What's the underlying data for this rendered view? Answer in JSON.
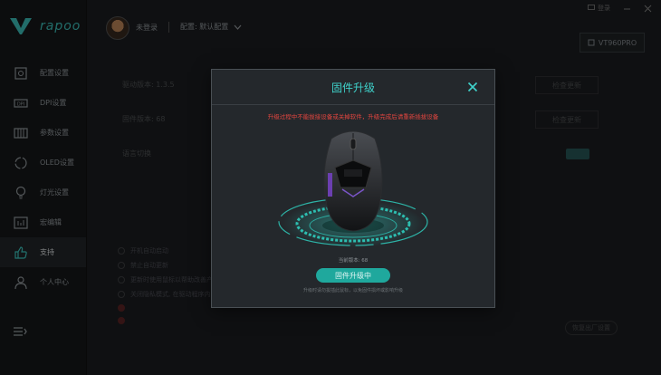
{
  "brand": {
    "logo_text": "rapoo"
  },
  "user": {
    "name": "未登录",
    "config": "配置: 默认配置"
  },
  "window": {
    "login_label": "登录",
    "device": "VT960PRO"
  },
  "sidebar": {
    "items": [
      {
        "label": "配置设置",
        "icon": "config-icon"
      },
      {
        "label": "DPI设置",
        "icon": "dpi-icon"
      },
      {
        "label": "参数设置",
        "icon": "params-icon"
      },
      {
        "label": "OLED设置",
        "icon": "oled-icon"
      },
      {
        "label": "灯光设置",
        "icon": "light-icon"
      },
      {
        "label": "宏编辑",
        "icon": "macro-icon"
      },
      {
        "label": "支持",
        "icon": "thumbs-up-icon"
      },
      {
        "label": "个人中心",
        "icon": "user-icon"
      }
    ]
  },
  "background": {
    "driver_version": "驱动版本: 1.3.5",
    "firmware_version": "固件版本: 68",
    "language": "语言切换",
    "check_update": "检查更新",
    "lang_value": "中",
    "options": [
      "开机自动启动",
      "禁止自动更新",
      "更新时使用鼠标以帮助改善产品",
      "关闭隐私模式, 在驱动程序内隐藏设备"
    ],
    "reset": "恢复出厂设置"
  },
  "modal": {
    "title": "固件升级",
    "warning": "升级过程中不能拔接设备或关掉软件，升级完成后请重新插拔设备",
    "current_version": "当前版本: 68",
    "button": "固件升级中",
    "hint": "升级时请勿拔插此鼠标，以免固件损坏或影响升级"
  },
  "colors": {
    "accent": "#3fd2cb",
    "warning": "#e2453f",
    "button": "#1fa89d"
  }
}
